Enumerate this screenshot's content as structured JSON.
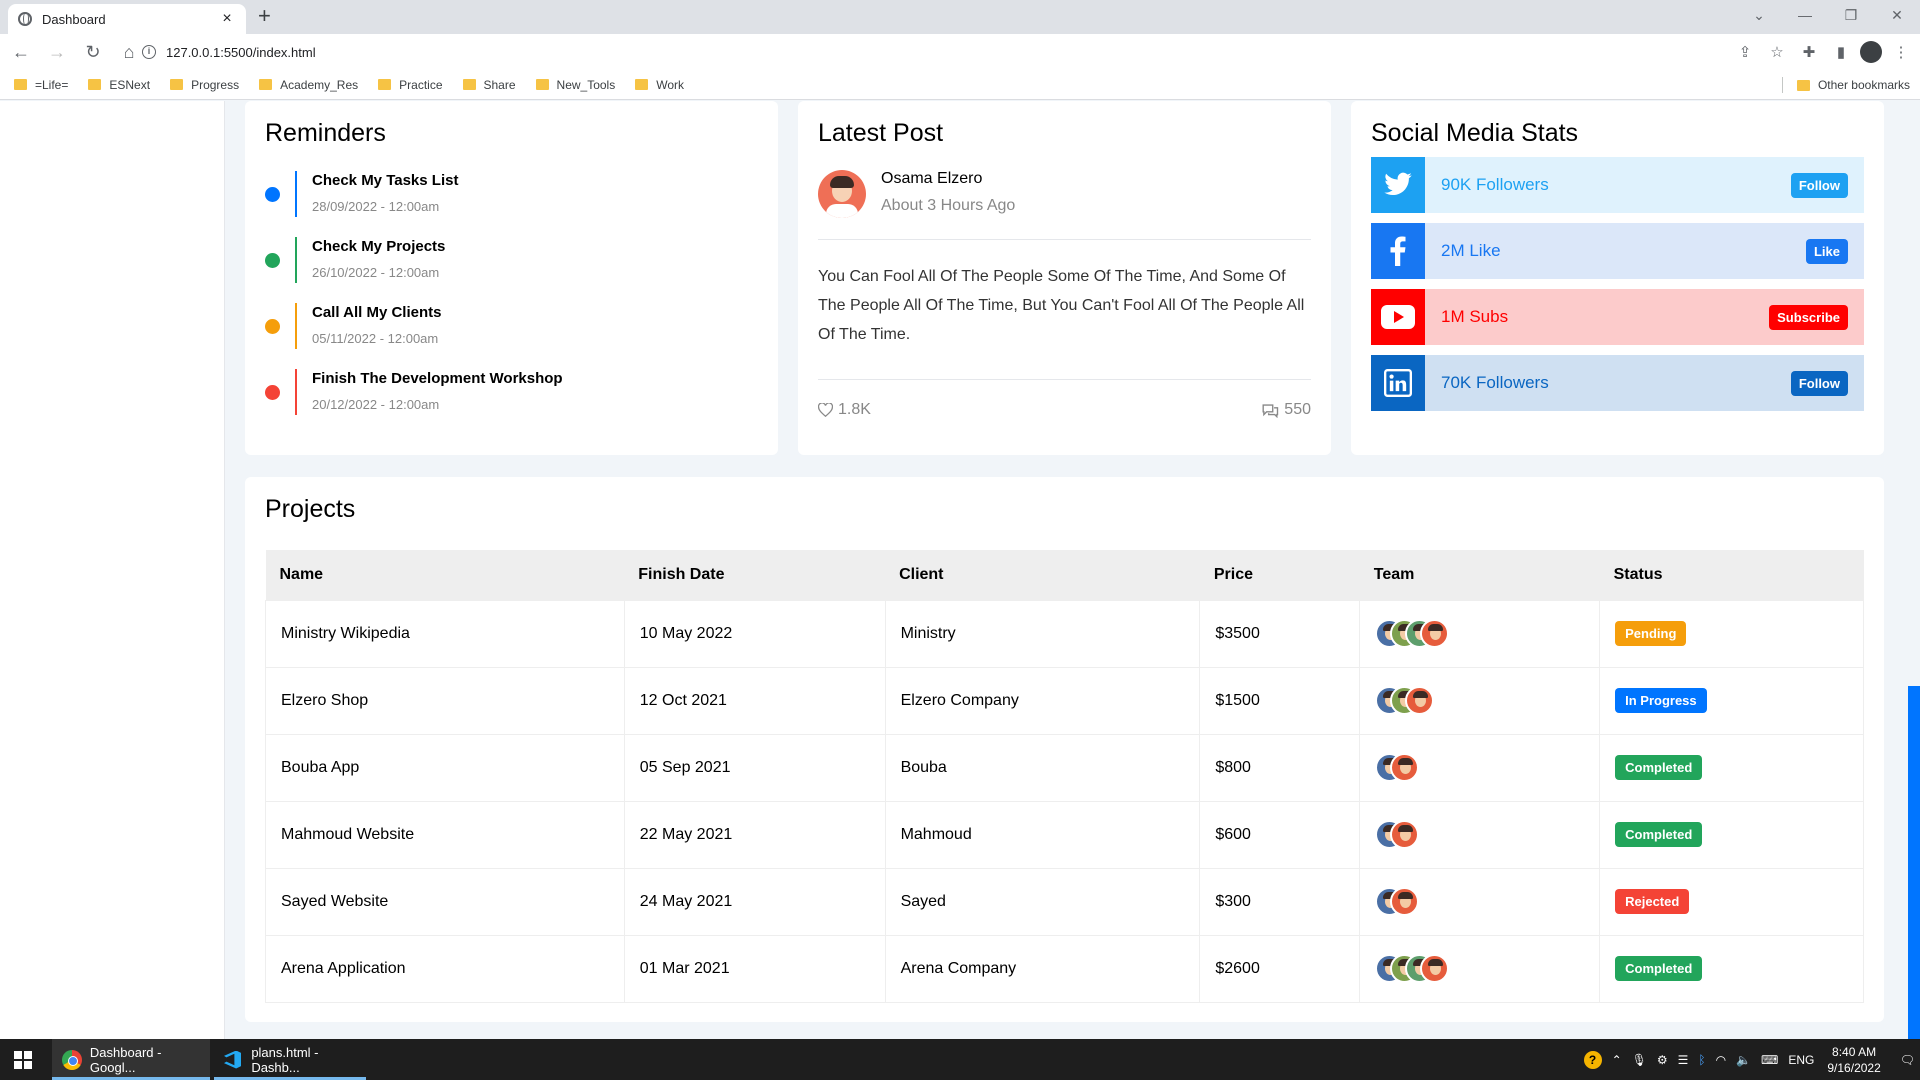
{
  "browser": {
    "tab_title": "Dashboard",
    "tab_close": "×",
    "new_tab": "+",
    "url": "127.0.0.1:5500/index.html",
    "bookmarks": [
      "=Life=",
      "ESNext",
      "Progress",
      "Academy_Res",
      "Practice",
      "Share",
      "New_Tools",
      "Work"
    ],
    "other_bookmarks": "Other bookmarks"
  },
  "reminders": {
    "title": "Reminders",
    "items": [
      {
        "title": "Check My Tasks List",
        "date": "28/09/2022 - 12:00am",
        "color": "#0075ff"
      },
      {
        "title": "Check My Projects",
        "date": "26/10/2022 - 12:00am",
        "color": "#22a55b"
      },
      {
        "title": "Call All My Clients",
        "date": "05/11/2022 - 12:00am",
        "color": "#f59e0b"
      },
      {
        "title": "Finish The Development Workshop",
        "date": "20/12/2022 - 12:00am",
        "color": "#f44336"
      }
    ]
  },
  "latest_post": {
    "title": "Latest Post",
    "author": "Osama Elzero",
    "time": "About 3 Hours Ago",
    "text": "You Can Fool All Of The People Some Of The Time, And Some Of The People All Of The Time, But You Can't Fool All Of The People All Of The Time.",
    "likes": "1.8K",
    "comments": "550"
  },
  "social": {
    "title": "Social Media Stats",
    "items": [
      {
        "network": "twitter",
        "text": "90K Followers",
        "button": "Follow",
        "color": "#1da1f2",
        "bg": "#dff2fd"
      },
      {
        "network": "facebook",
        "text": "2M Like",
        "button": "Like",
        "color": "#1877f2",
        "bg": "#dbe7f9"
      },
      {
        "network": "youtube",
        "text": "1M Subs",
        "button": "Subscribe",
        "color": "#ff0000",
        "bg": "#fccbcb"
      },
      {
        "network": "linkedin",
        "text": "70K Followers",
        "button": "Follow",
        "color": "#0a66c2",
        "bg": "#cfe0f2"
      }
    ]
  },
  "projects": {
    "title": "Projects",
    "columns": [
      "Name",
      "Finish Date",
      "Client",
      "Price",
      "Team",
      "Status"
    ],
    "rows": [
      {
        "name": "Ministry Wikipedia",
        "date": "10 May 2022",
        "client": "Ministry",
        "price": "$3500",
        "team": 4,
        "status": "Pending",
        "status_color": "#f59e0b"
      },
      {
        "name": "Elzero Shop",
        "date": "12 Oct 2021",
        "client": "Elzero Company",
        "price": "$1500",
        "team": 3,
        "status": "In Progress",
        "status_color": "#0075ff"
      },
      {
        "name": "Bouba App",
        "date": "05 Sep 2021",
        "client": "Bouba",
        "price": "$800",
        "team": 2,
        "status": "Completed",
        "status_color": "#22a55b"
      },
      {
        "name": "Mahmoud Website",
        "date": "22 May 2021",
        "client": "Mahmoud",
        "price": "$600",
        "team": 2,
        "status": "Completed",
        "status_color": "#22a55b"
      },
      {
        "name": "Sayed Website",
        "date": "24 May 2021",
        "client": "Sayed",
        "price": "$300",
        "team": 2,
        "status": "Rejected",
        "status_color": "#f44336"
      },
      {
        "name": "Arena Application",
        "date": "01 Mar 2021",
        "client": "Arena Company",
        "price": "$2600",
        "team": 4,
        "status": "Completed",
        "status_color": "#22a55b"
      }
    ]
  },
  "taskbar": {
    "apps": [
      "Dashboard - Googl...",
      "plans.html - Dashb..."
    ],
    "lang": "ENG",
    "time": "8:40 AM",
    "date": "9/16/2022"
  }
}
